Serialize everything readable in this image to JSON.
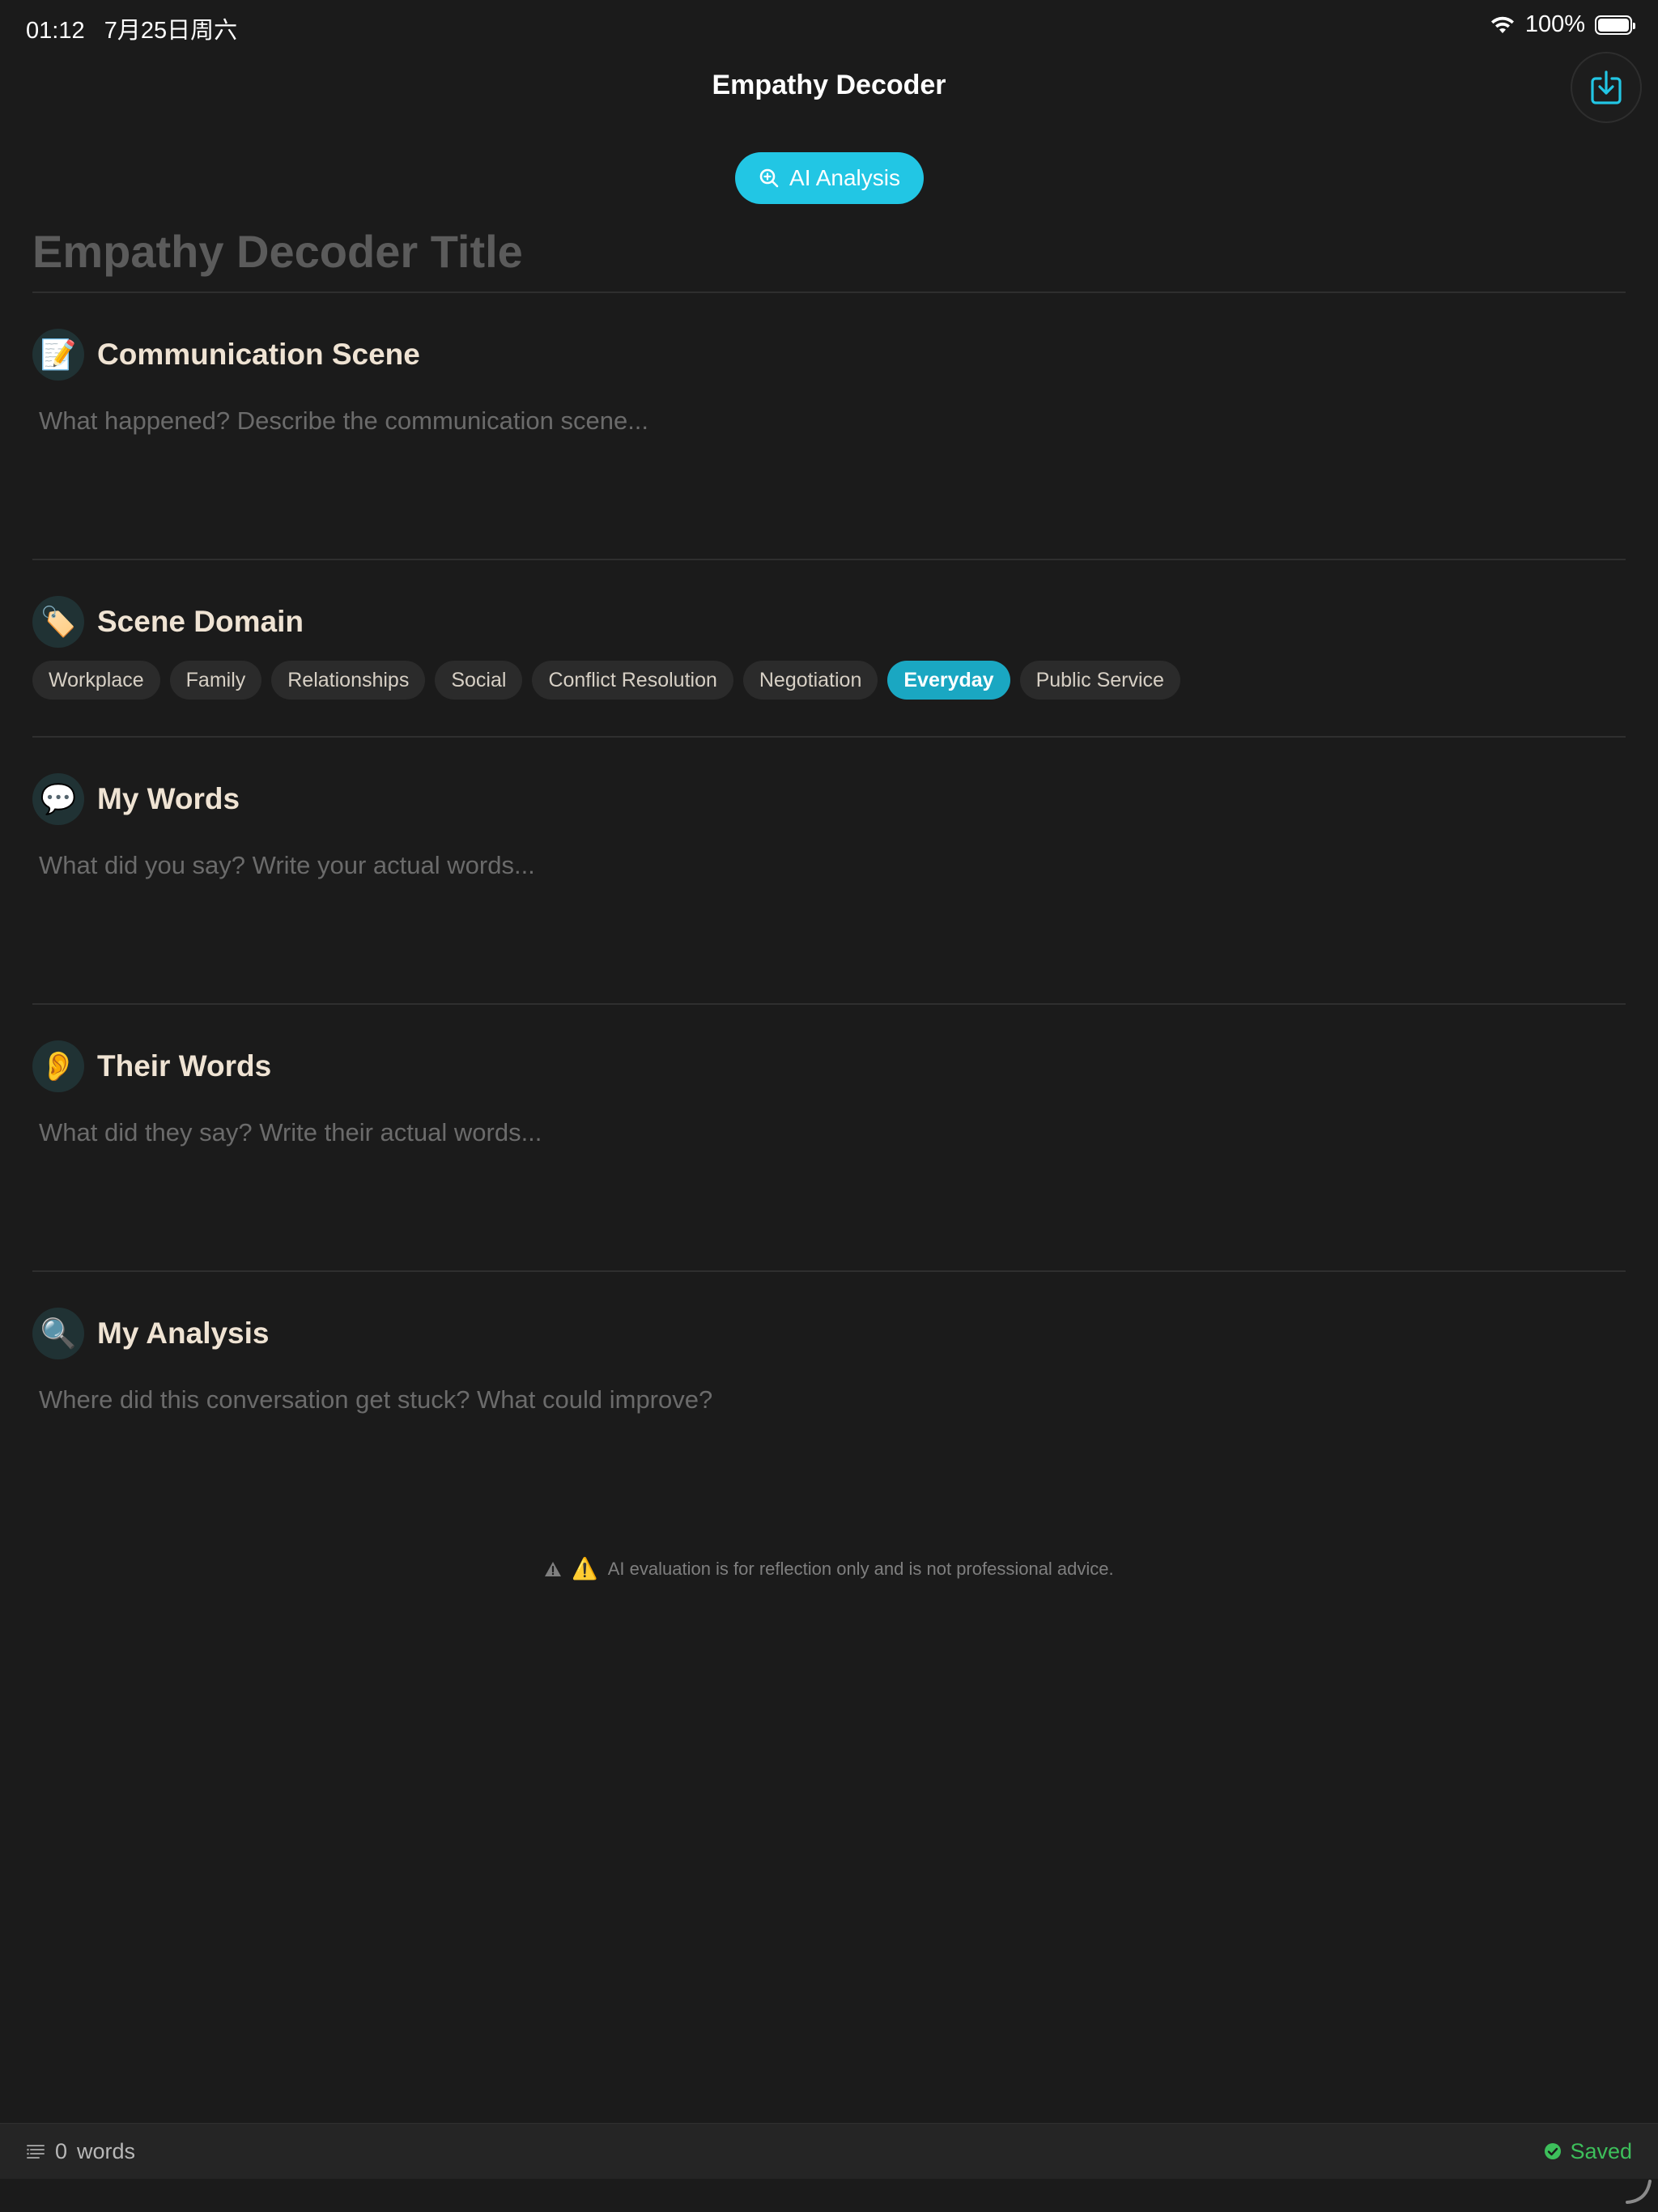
{
  "status_bar": {
    "time": "01:12",
    "date": "7月25日周六",
    "battery": "100%"
  },
  "header": {
    "title": "Empathy Decoder"
  },
  "ai_button": {
    "label": "AI Analysis"
  },
  "document": {
    "title_placeholder": "Empathy Decoder Title"
  },
  "sections": {
    "scene": {
      "icon": "📝",
      "title": "Communication Scene",
      "placeholder": "What happened? Describe the communication scene..."
    },
    "domain": {
      "icon": "🏷️",
      "title": "Scene Domain",
      "options": [
        "Workplace",
        "Family",
        "Relationships",
        "Social",
        "Conflict Resolution",
        "Negotiation",
        "Everyday",
        "Public Service"
      ],
      "selected": "Everyday"
    },
    "my_words": {
      "icon": "💬",
      "title": "My Words",
      "placeholder": "What did you say? Write your actual words..."
    },
    "their_words": {
      "icon": "👂",
      "title": "Their Words",
      "placeholder": "What did they say? Write their actual words..."
    },
    "analysis": {
      "icon": "🔍",
      "title": "My Analysis",
      "placeholder": "Where did this conversation get stuck? What could improve?"
    }
  },
  "disclaimer": {
    "emoji": "⚠️",
    "text": "AI evaluation is for reflection only and is not professional advice."
  },
  "footer": {
    "word_count": "0",
    "word_label": "words",
    "status": "Saved"
  },
  "colors": {
    "accent": "#22c6e4",
    "selected_chip": "#1aa7c2",
    "saved_green": "#3dbf5b",
    "background": "#1b1b1b"
  }
}
